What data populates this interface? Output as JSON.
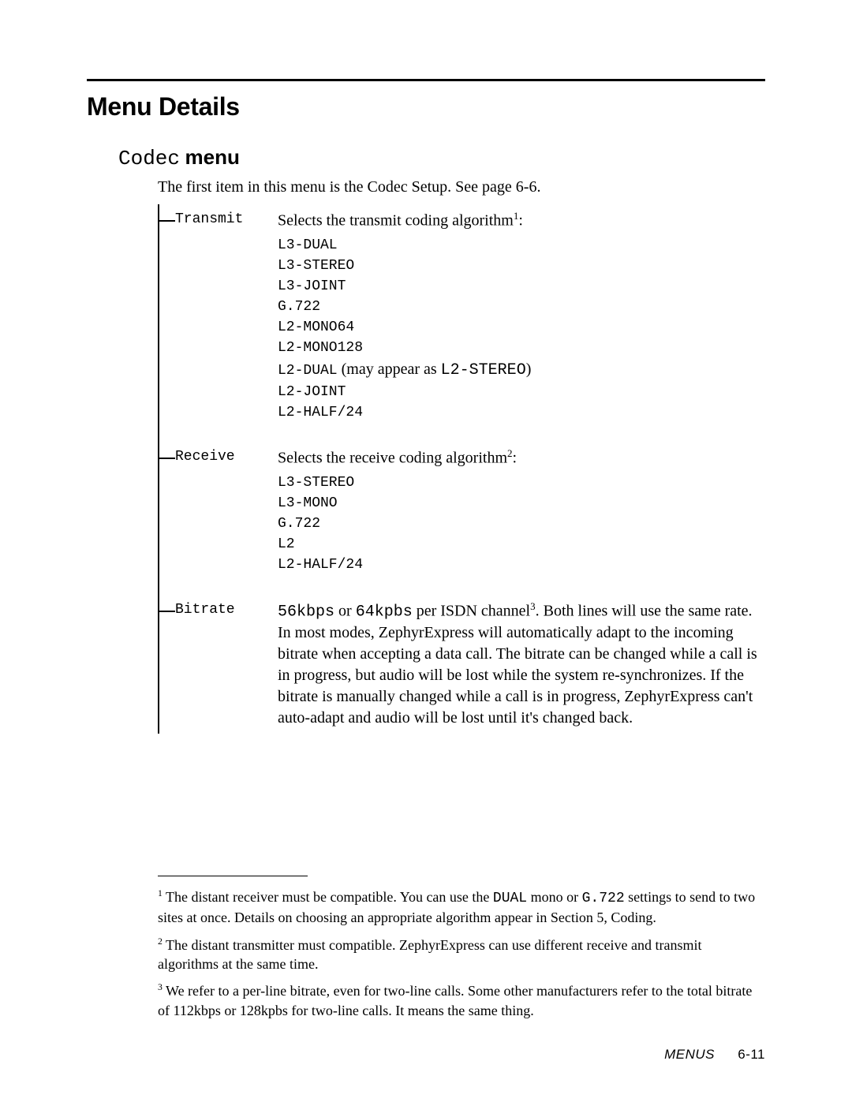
{
  "section_title": "Menu Details",
  "codec_heading": {
    "codec_word": "Codec",
    "menu_word": "menu"
  },
  "intro": "The first item in this menu is the Codec Setup. See page 6-6.",
  "items": [
    {
      "label": "Transmit",
      "lead_pre": "Selects the transmit coding algorithm",
      "sup": "1",
      "lead_post": ":",
      "options": [
        {
          "code": "L3-DUAL"
        },
        {
          "code": "L3-STEREO"
        },
        {
          "code": "L3-JOINT"
        },
        {
          "code": "G.722"
        },
        {
          "code": "L2-MONO64"
        },
        {
          "code": "L2-MONO128"
        },
        {
          "code": "L2-DUAL",
          "paren_pre": "  (may appear as ",
          "paren_code": "L2-STEREO",
          "paren_post": ")"
        },
        {
          "code": "L2-JOINT"
        },
        {
          "code": "L2-HALF/24"
        }
      ]
    },
    {
      "label": "Receive",
      "lead_pre": "Selects the receive coding algorithm",
      "sup": "2",
      "lead_post": ":",
      "options": [
        {
          "code": "L3-STEREO"
        },
        {
          "code": "L3-MONO"
        },
        {
          "code": "G.722"
        },
        {
          "code": "L2"
        },
        {
          "code": "L2-HALF/24"
        }
      ]
    },
    {
      "label": "Bitrate",
      "body_parts": [
        {
          "t": "mono",
          "v": "56kbps"
        },
        {
          "t": "text",
          "v": " or "
        },
        {
          "t": "mono",
          "v": "64kpbs"
        },
        {
          "t": "text",
          "v": " per ISDN channel"
        },
        {
          "t": "sup",
          "v": "3"
        },
        {
          "t": "text",
          "v": ". Both lines will use the same rate. In most modes, ZephyrExpress will automatically adapt to the incoming bitrate when accepting a data call. The bitrate can be changed while a call is in progress, but audio will be lost while the system re-synchronizes. If the bitrate is manually changed while a call is in progress, ZephyrExpress can't auto-adapt and audio will be lost until it's changed back."
        }
      ]
    }
  ],
  "footnotes": [
    {
      "parts": [
        {
          "t": "sup",
          "v": "1"
        },
        {
          "t": "text",
          "v": " The distant receiver must be compatible. You can use the "
        },
        {
          "t": "mono",
          "v": "DUAL"
        },
        {
          "t": "text",
          "v": " mono or "
        },
        {
          "t": "mono",
          "v": "G.722"
        },
        {
          "t": "text",
          "v": " settings to send to two sites at once. Details on choosing an appropriate algorithm appear in Section 5, Coding."
        }
      ]
    },
    {
      "parts": [
        {
          "t": "sup",
          "v": "2"
        },
        {
          "t": "text",
          "v": " The distant transmitter must compatible. ZephyrExpress can use different receive and transmit algorithms at the same time."
        }
      ]
    },
    {
      "parts": [
        {
          "t": "sup",
          "v": "3"
        },
        {
          "t": "text",
          "v": " We refer to a per-line bitrate, even for two-line calls. Some other manufacturers refer to the total bitrate of 112kbps or 128kpbs for two-line calls. It means the same thing."
        }
      ]
    }
  ],
  "footer": {
    "label": "MENUS",
    "page": "6-11"
  }
}
